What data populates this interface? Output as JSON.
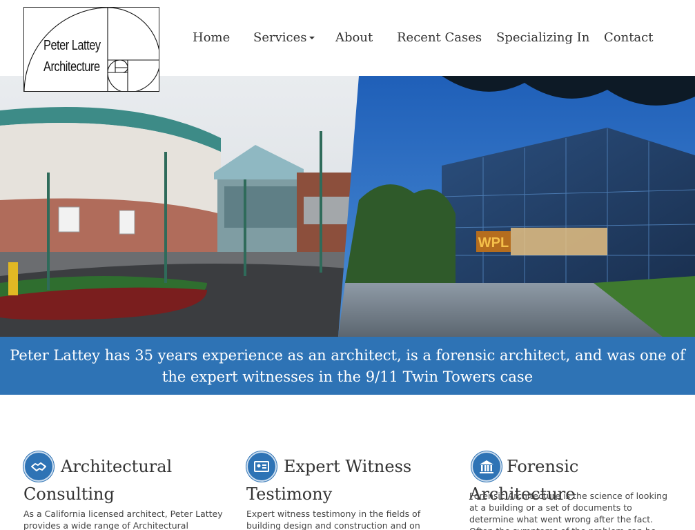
{
  "logo": {
    "line1": "Peter Lattey",
    "line2": "Architecture"
  },
  "nav": {
    "items": [
      {
        "label": "Home"
      },
      {
        "label": "Services",
        "has_dropdown": true
      },
      {
        "label": "About"
      },
      {
        "label": "Recent Cases"
      },
      {
        "label": "Specializing In"
      },
      {
        "label": "Contact"
      }
    ]
  },
  "hero": {
    "left_scene": "civic-building-photo",
    "right_scene": "wpl-glass-building-photo",
    "sign_text": "WPL"
  },
  "banner": {
    "text": "Peter Lattey has 35 years experience as an architect, is a forensic architect, and was one of the expert witnesses in the 9/11 Twin Towers case"
  },
  "features": [
    {
      "icon": "handshake-icon",
      "title": "Architectural Consulting",
      "text": "As a California licensed architect, Peter Lattey provides a wide range of Architectural services."
    },
    {
      "icon": "id-card-icon",
      "title": "Expert Witness Testimony",
      "text": "Expert witness testimony in the fields of building design and construction and on quality review of"
    },
    {
      "icon": "bank-building-icon",
      "title": "Forensic Architecture",
      "text": "Forensic Architecture is the science of looking at a building or a set of documents to determine what went wrong after the fact. Often the symptoms of the problem can be subtle and"
    }
  ],
  "colors": {
    "accent": "#2e73b5",
    "text": "#333333"
  }
}
